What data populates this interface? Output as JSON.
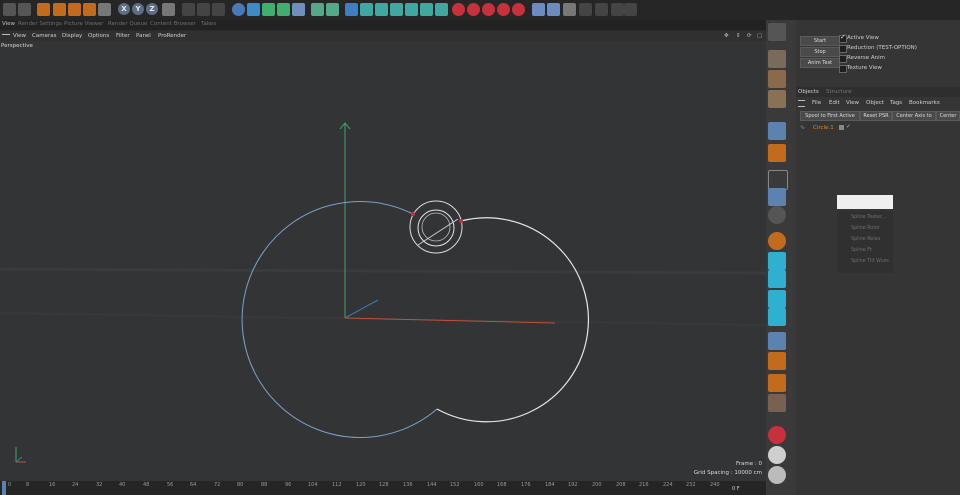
{
  "toolbar": {
    "axis_letters": [
      "X",
      "Y",
      "Z"
    ]
  },
  "tabs": [
    {
      "label": "View",
      "active": true
    },
    {
      "label": "Render Settings",
      "active": false
    },
    {
      "label": "Picture Viewer",
      "active": false
    },
    {
      "label": "Render Queue",
      "active": false
    },
    {
      "label": "Content Browser",
      "active": false
    },
    {
      "label": "Takes",
      "active": false
    }
  ],
  "viewport_menu": [
    "View",
    "Cameras",
    "Display",
    "Options",
    "Filter",
    "Panel",
    "ProRender"
  ],
  "viewport": {
    "label": "Perspective",
    "frame": "Frame : 0",
    "grid_spacing": "Grid Spacing : 10000 cm"
  },
  "timeline": {
    "ticks": [
      "0",
      "8",
      "16",
      "24",
      "32",
      "40",
      "48",
      "56",
      "64",
      "72",
      "80",
      "88",
      "96",
      "104",
      "112",
      "120",
      "128",
      "136",
      "144",
      "152",
      "160",
      "168",
      "176",
      "184",
      "192",
      "200",
      "208",
      "216",
      "224",
      "232",
      "240"
    ],
    "current": "0 F"
  },
  "attributes": {
    "buttons": [
      "Start",
      "Stop",
      "Anim Test"
    ],
    "options": [
      {
        "label": "Active View",
        "checked": true
      },
      {
        "label": "Reduction (TEST-OPTION)",
        "checked": false
      },
      {
        "label": "Reverse Anim",
        "checked": false
      },
      {
        "label": "Texture View",
        "checked": false
      }
    ]
  },
  "objects_panel": {
    "tabs": [
      "Objects",
      "Structure"
    ],
    "menu": [
      "File",
      "Edit",
      "View",
      "Object",
      "Tags",
      "Bookmarks"
    ],
    "buttons": [
      "Spool to First Active",
      "Reset PSR",
      "Center Axis to",
      "Center O"
    ],
    "object_name": "Circle.1",
    "context_menu": [
      "Spline Teeter...",
      "Spline Rotor",
      "Spline Relax",
      "Spline Ft",
      "Spline Tilt Wuss"
    ]
  },
  "colors": {
    "accent": "#e08a1e",
    "selection": "#5c82b0",
    "spline_white": "#e6e6e6",
    "spline_blue": "#7f9fc8",
    "x_axis": "#c0513a",
    "y_axis": "#3fa36a",
    "z_axis": "#3f78b0"
  },
  "icons": [
    "undo-icon",
    "redo-icon",
    "move-icon",
    "scale-icon",
    "rotate-icon",
    "render-icon",
    "cube-icon",
    "spline-pen-icon",
    "camera-icon",
    "light-icon",
    "magnet-icon",
    "snap-icon",
    "lock-icon"
  ]
}
